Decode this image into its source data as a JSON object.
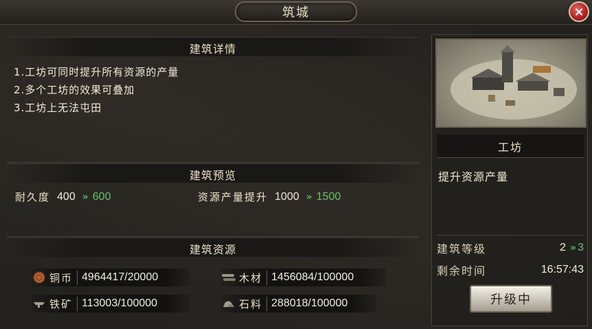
{
  "window": {
    "title": "筑城",
    "close_label": "×"
  },
  "details": {
    "header": "建筑详情",
    "lines": [
      "1.工坊可同时提升所有资源的产量",
      "2.多个工坊的效果可叠加",
      "3.工坊上无法屯田"
    ]
  },
  "preview": {
    "header": "建筑预览",
    "durability": {
      "label": "耐久度",
      "current": "400",
      "next": "600"
    },
    "production": {
      "label": "资源产量提升",
      "current": "1000",
      "next": "1500"
    },
    "arrow": "»"
  },
  "resources": {
    "header": "建筑资源",
    "items": [
      {
        "name": "铜币",
        "value": "4964417/20000",
        "icon": "copper-coin-icon"
      },
      {
        "name": "木材",
        "value": "1456084/100000",
        "icon": "wood-icon"
      },
      {
        "name": "铁矿",
        "value": "113003/100000",
        "icon": "iron-ore-icon"
      },
      {
        "name": "石料",
        "value": "288018/100000",
        "icon": "stone-icon"
      }
    ]
  },
  "building": {
    "name": "工坊",
    "description": "提升资源产量",
    "level_label": "建筑等级",
    "level_current": "2",
    "level_next": "3",
    "time_label": "剩余时间",
    "time_value": "16:57:43",
    "upgrade_button": "升级中"
  },
  "colors": {
    "accent_green": "#6bc26b",
    "close_red": "#c53030",
    "panel_bg": "#24221f"
  }
}
